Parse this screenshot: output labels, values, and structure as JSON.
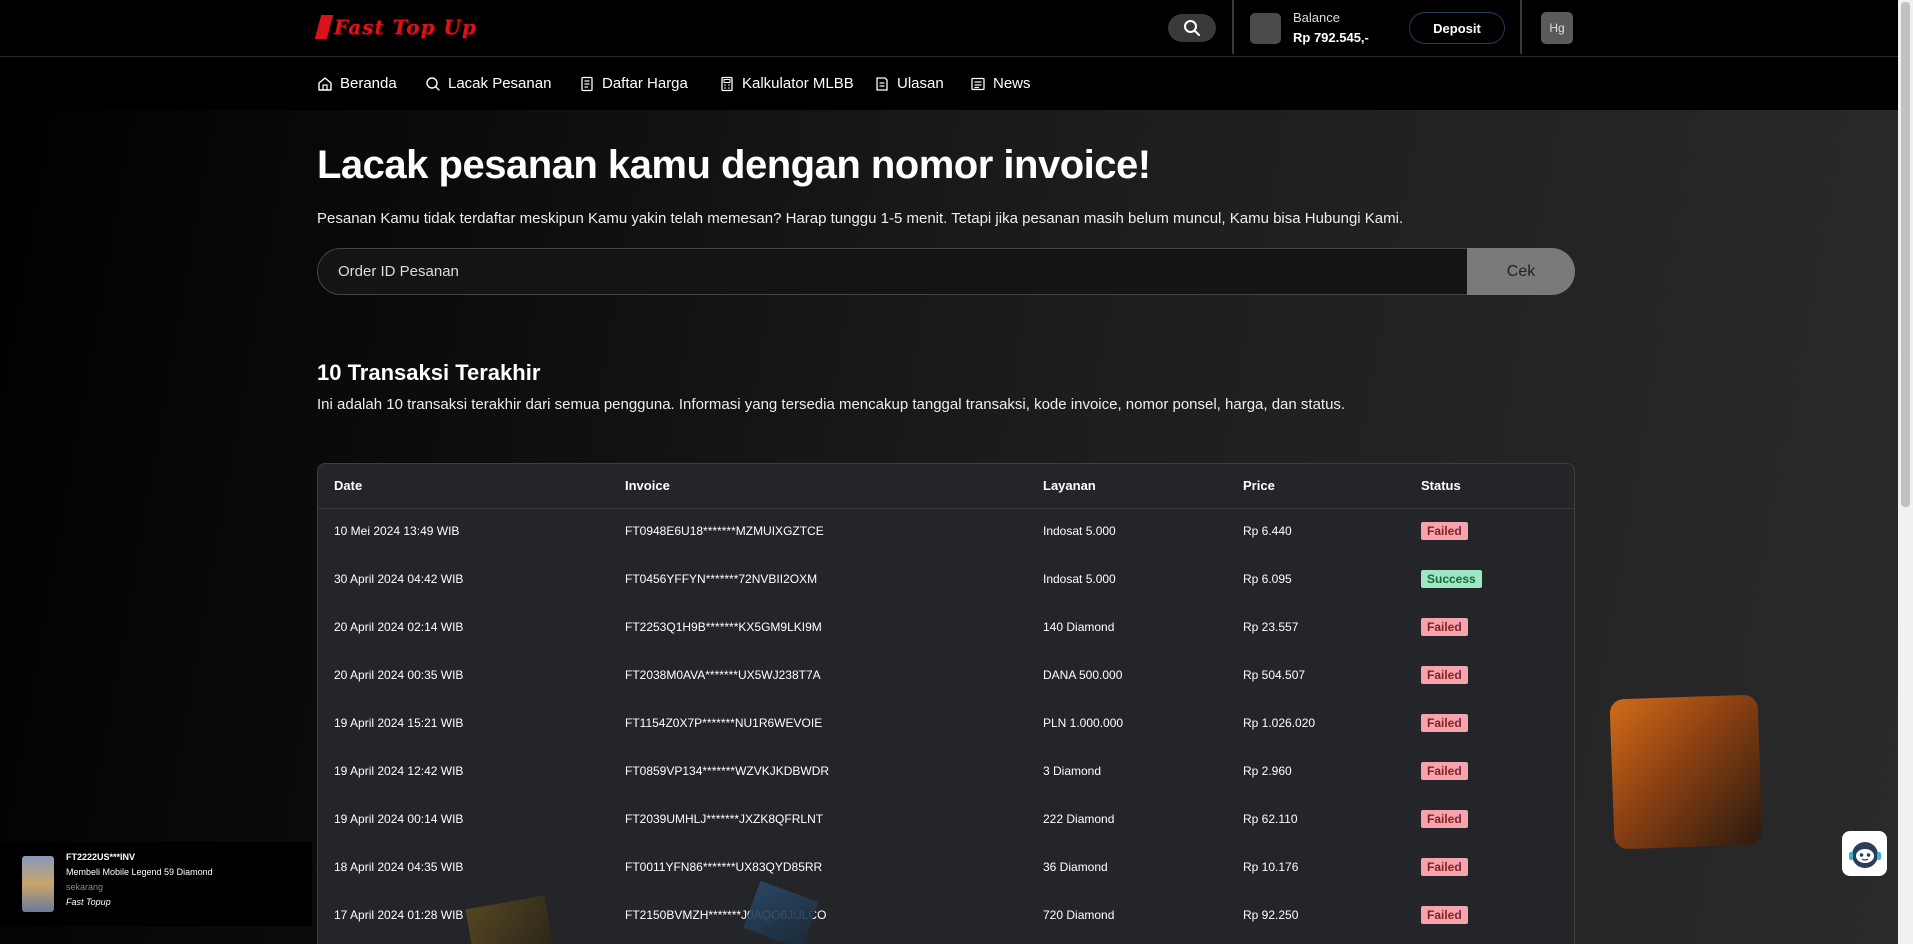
{
  "brand": {
    "logo_text": "Fast Top Up"
  },
  "header": {
    "balance_label": "Balance",
    "balance_value": "Rp 792.545,-",
    "deposit_label": "Deposit",
    "avatar_initials": "Hg"
  },
  "nav": {
    "items": [
      {
        "label": "Beranda",
        "icon": "home-icon"
      },
      {
        "label": "Lacak Pesanan",
        "icon": "search-icon"
      },
      {
        "label": "Daftar Harga",
        "icon": "price-list-icon"
      },
      {
        "label": "Kalkulator MLBB",
        "icon": "calculator-icon"
      },
      {
        "label": "Ulasan",
        "icon": "review-icon"
      },
      {
        "label": "News",
        "icon": "news-icon"
      }
    ]
  },
  "track": {
    "headline": "Lacak pesanan kamu dengan nomor invoice!",
    "subtitle": "Pesanan Kamu tidak terdaftar meskipun Kamu yakin telah memesan? Harap tunggu 1-5 menit. Tetapi jika pesanan masih belum muncul, Kamu bisa Hubungi Kami.",
    "input_placeholder": "Order ID Pesanan",
    "check_label": "Cek"
  },
  "transactions": {
    "title": "10 Transaksi Terakhir",
    "description": "Ini adalah 10 transaksi terakhir dari semua pengguna. Informasi yang tersedia mencakup tanggal transaksi, kode invoice, nomor ponsel, harga, dan status.",
    "columns": [
      "Date",
      "Invoice",
      "Layanan",
      "Price",
      "Status"
    ],
    "rows": [
      {
        "date": "10 Mei 2024 13:49 WIB",
        "invoice": "FT0948E6U18*******MZMUIXGZTCE",
        "service": "Indosat 5.000",
        "price": "Rp 6.440",
        "status": "Failed"
      },
      {
        "date": "30 April 2024 04:42 WIB",
        "invoice": "FT0456YFFYN*******72NVBII2OXM",
        "service": "Indosat 5.000",
        "price": "Rp 6.095",
        "status": "Success"
      },
      {
        "date": "20 April 2024 02:14 WIB",
        "invoice": "FT2253Q1H9B*******KX5GM9LKI9M",
        "service": "140 Diamond",
        "price": "Rp 23.557",
        "status": "Failed"
      },
      {
        "date": "20 April 2024 00:35 WIB",
        "invoice": "FT2038M0AVA*******UX5WJ238T7A",
        "service": "DANA 500.000",
        "price": "Rp 504.507",
        "status": "Failed"
      },
      {
        "date": "19 April 2024 15:21 WIB",
        "invoice": "FT1154Z0X7P*******NU1R6WEVOIE",
        "service": "PLN 1.000.000",
        "price": "Rp 1.026.020",
        "status": "Failed"
      },
      {
        "date": "19 April 2024 12:42 WIB",
        "invoice": "FT0859VP134*******WZVKJKDBWDR",
        "service": "3 Diamond",
        "price": "Rp 2.960",
        "status": "Failed"
      },
      {
        "date": "19 April 2024 00:14 WIB",
        "invoice": "FT2039UMHLJ*******JXZK8QFRLNT",
        "service": "222 Diamond",
        "price": "Rp 62.110",
        "status": "Failed"
      },
      {
        "date": "18 April 2024 04:35 WIB",
        "invoice": "FT0011YFN86*******UX83QYD85RR",
        "service": "36 Diamond",
        "price": "Rp 10.176",
        "status": "Failed"
      },
      {
        "date": "17 April 2024 01:28 WIB",
        "invoice": "FT2150BVMZH*******J0AQO6JULCO",
        "service": "720 Diamond",
        "price": "Rp 92.250",
        "status": "Failed"
      }
    ]
  },
  "toast": {
    "title": "FT2222US***INV",
    "message": "Membeli Mobile Legend 59 Diamond",
    "time": "sekarang",
    "source": "Fast Topup"
  },
  "colors": {
    "failed_bg": "#f3a4ac",
    "success_bg": "#9fe6c4",
    "deposit_border": "#2b3a66"
  }
}
